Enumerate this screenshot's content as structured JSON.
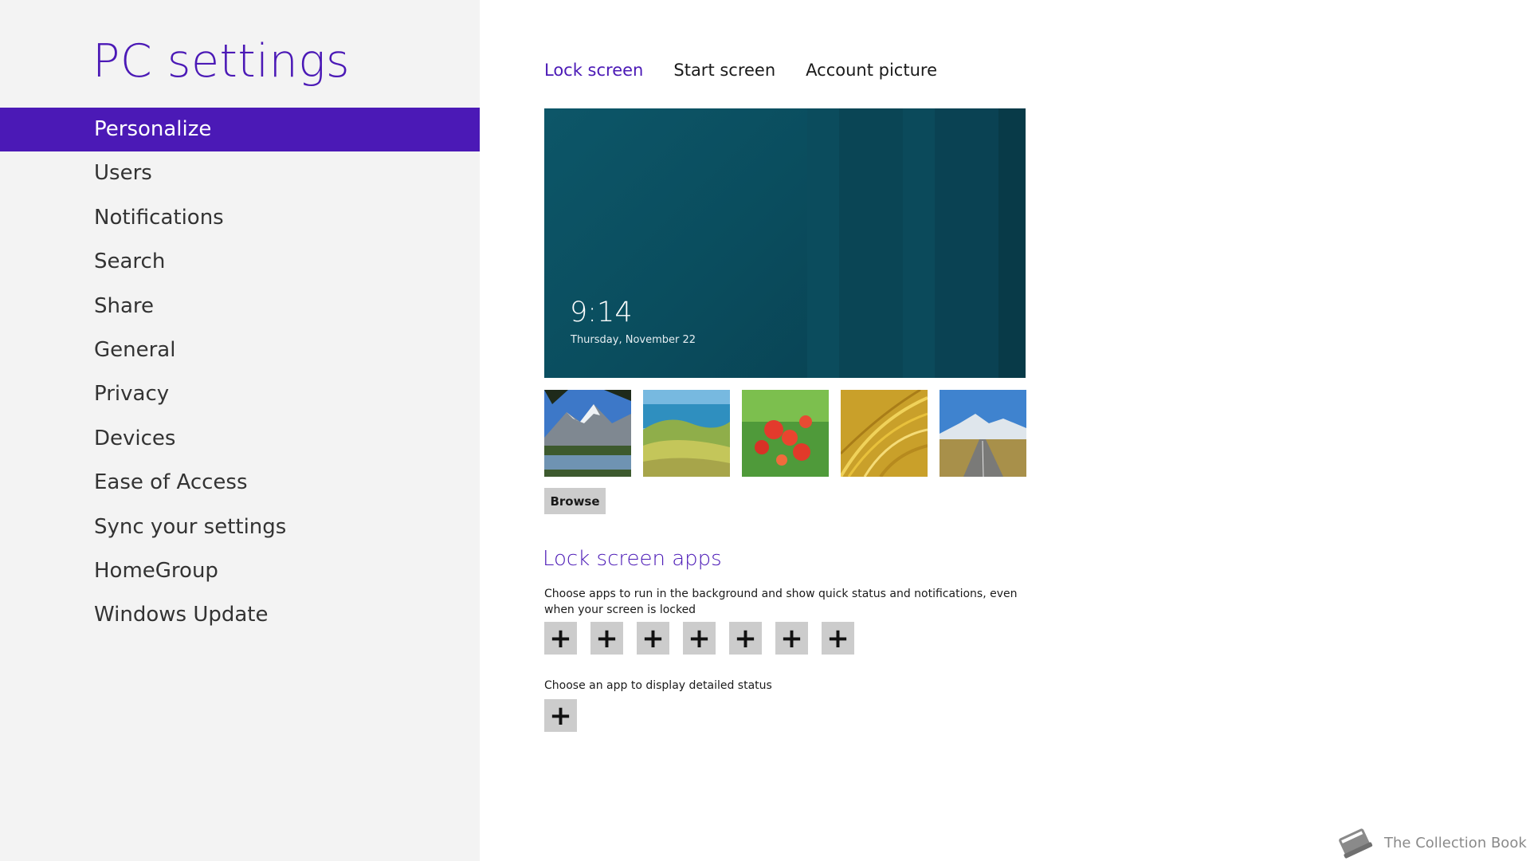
{
  "app_title": "PC settings",
  "nav": {
    "items": [
      {
        "label": "Personalize",
        "active": true
      },
      {
        "label": "Users"
      },
      {
        "label": "Notifications"
      },
      {
        "label": "Search"
      },
      {
        "label": "Share"
      },
      {
        "label": "General"
      },
      {
        "label": "Privacy"
      },
      {
        "label": "Devices"
      },
      {
        "label": "Ease of Access"
      },
      {
        "label": "Sync your settings"
      },
      {
        "label": "HomeGroup"
      },
      {
        "label": "Windows Update"
      }
    ]
  },
  "tabs": [
    {
      "label": "Lock screen",
      "active": true
    },
    {
      "label": "Start screen"
    },
    {
      "label": "Account picture"
    }
  ],
  "lock_preview": {
    "time": "9:14",
    "date": "Thursday, November 22"
  },
  "thumbnails": [
    {
      "name": "mountain-lake"
    },
    {
      "name": "coastal-hills"
    },
    {
      "name": "red-flowers"
    },
    {
      "name": "golden-grass"
    },
    {
      "name": "mountain-road"
    }
  ],
  "browse_label": "Browse",
  "lock_apps": {
    "title": "Lock screen apps",
    "description": "Choose apps to run in the background and show quick status and notifications, even when your screen is locked",
    "slot_symbol": "+",
    "detail_description": "Choose an app to display detailed status"
  },
  "watermark": "The Collection Book",
  "colors": {
    "accent": "#4b19b6",
    "sidebar_bg": "#f3f3f3",
    "preview_bg": "#0a4858",
    "slot_bg": "#cccccc"
  }
}
